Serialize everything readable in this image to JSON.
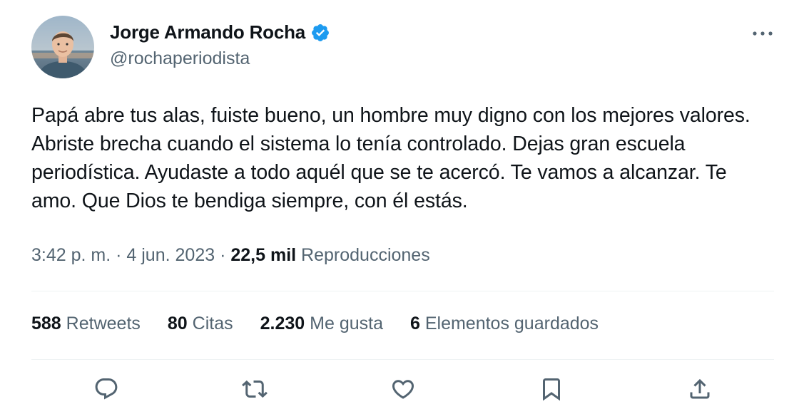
{
  "author": {
    "display_name": "Jorge Armando Rocha",
    "handle": "@rochaperiodista",
    "verified": true,
    "verified_color": "#1d9bf0"
  },
  "tweet": {
    "text": "Papá abre tus alas, fuiste bueno, un hombre muy digno con los mejores valores. Abriste brecha cuando el sistema lo tenía controlado. Dejas gran escuela periodística.  Ayudaste a todo aquél que se te acercó. Te vamos a alcanzar. Te amo. Que Dios te bendiga siempre, con él estás.",
    "time": "3:42 p. m.",
    "separator": "·",
    "date": "4 jun. 2023",
    "views_count": "22,5 mil",
    "views_label": "Reproducciones"
  },
  "stats": {
    "retweets": {
      "count": "588",
      "label": "Retweets"
    },
    "quotes": {
      "count": "80",
      "label": "Citas"
    },
    "likes": {
      "count": "2.230",
      "label": "Me gusta"
    },
    "bookmarks": {
      "count": "6",
      "label": "Elementos guardados"
    }
  },
  "icons": {
    "more": "more-icon",
    "reply": "reply-icon",
    "retweet": "retweet-icon",
    "like": "heart-icon",
    "bookmark": "bookmark-icon",
    "share": "share-icon"
  },
  "colors": {
    "text": "#0f1419",
    "secondary": "#536471",
    "divider": "#eff3f4"
  }
}
